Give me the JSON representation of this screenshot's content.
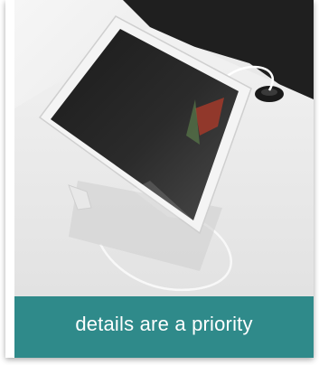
{
  "card": {
    "image_subject": "tablet-on-stand",
    "caption": "details are a priority",
    "caption_background": "#2f8a8a",
    "caption_color": "#ffffff"
  }
}
